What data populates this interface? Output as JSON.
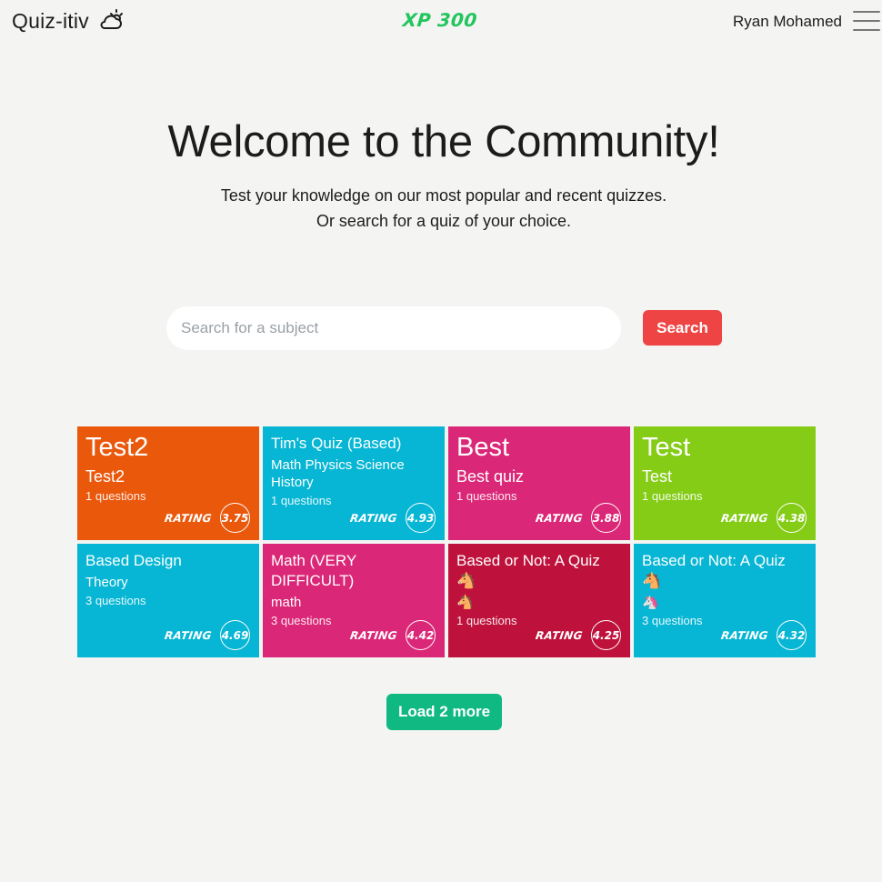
{
  "header": {
    "brand": "Quiz-itiv",
    "brand_icon": "cloud-sun-icon",
    "xp": "XP 300",
    "username": "Ryan Mohamed",
    "menu_icon": "hamburger-menu-icon"
  },
  "hero": {
    "title": "Welcome to the Community!",
    "line1": "Test your knowledge on our most popular and recent quizzes.",
    "line2": "Or search for a quiz of your choice."
  },
  "search": {
    "placeholder": "Search for a subject",
    "value": "",
    "button": "Search"
  },
  "quizzes": [
    {
      "title": "Test2",
      "description": "Test2",
      "questions": "1 questions",
      "rating_label": "RATING",
      "rating": "3.75",
      "color": "#ea580c"
    },
    {
      "title": "Tim's Quiz (Based)",
      "description": "Math Physics Science History",
      "questions": "1 questions",
      "rating_label": "RATING",
      "rating": "4.93",
      "color": "#06b6d4"
    },
    {
      "title": "Best",
      "description": "Best quiz",
      "questions": "1 questions",
      "rating_label": "RATING",
      "rating": "3.88",
      "color": "#db2777"
    },
    {
      "title": "Test",
      "description": "Test",
      "questions": "1 questions",
      "rating_label": "RATING",
      "rating": "4.38",
      "color": "#84cc16"
    },
    {
      "title": "Based Design",
      "description": "Theory",
      "questions": "3 questions",
      "rating_label": "RATING",
      "rating": "4.69",
      "color": "#06b6d4"
    },
    {
      "title": "Math (VERY DIFFICULT)",
      "description": "math",
      "questions": "3 questions",
      "rating_label": "RATING",
      "rating": "4.42",
      "color": "#db2777"
    },
    {
      "title": "Based or Not: A Quiz 🐴",
      "description": "🐴",
      "questions": "1 questions",
      "rating_label": "RATING",
      "rating": "4.25",
      "color": "#be123c"
    },
    {
      "title": "Based or Not: A Quiz 🐴",
      "description": "🦄",
      "questions": "3 questions",
      "rating_label": "RATING",
      "rating": "4.32",
      "color": "#06b6d4"
    }
  ],
  "load_more": "Load 2 more"
}
